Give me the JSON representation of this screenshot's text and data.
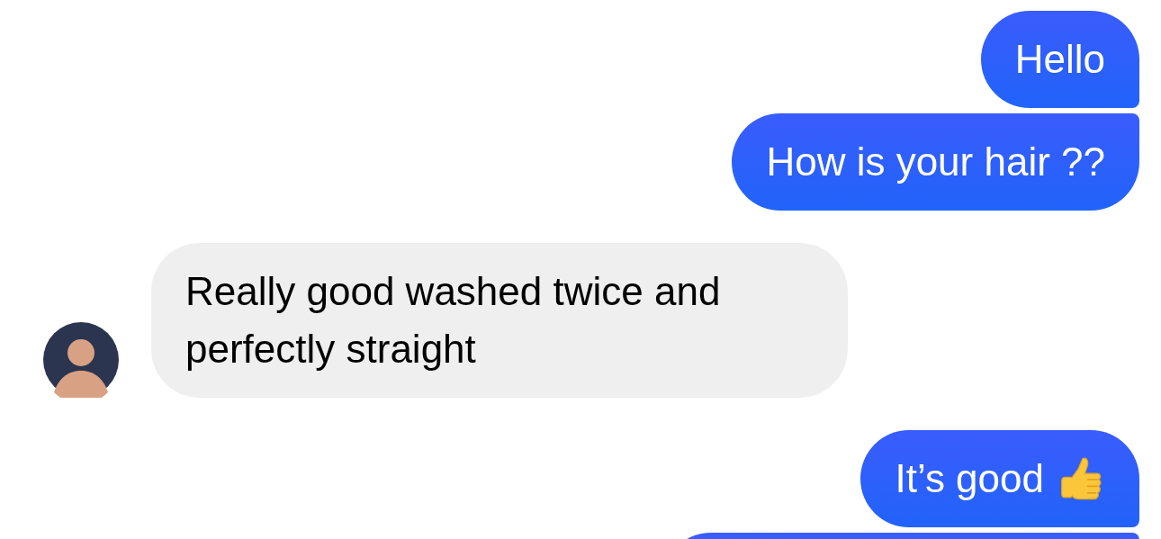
{
  "messages": [
    {
      "kind": "outgoing",
      "text": "Hello"
    },
    {
      "kind": "outgoing",
      "text": "How is your hair ??"
    },
    {
      "kind": "incoming",
      "text": "Really good washed twice and perfectly straight"
    },
    {
      "kind": "outgoing",
      "text": "It’s good",
      "trailing_icon": true
    },
    {
      "kind": "outgoing"
    }
  ]
}
